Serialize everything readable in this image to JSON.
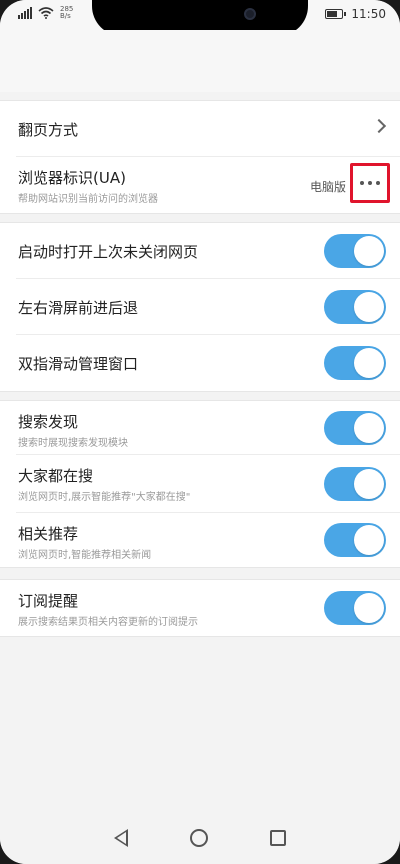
{
  "status_bar": {
    "speed_top": "285",
    "speed_unit": "B/s",
    "time": "11:50",
    "icons": [
      "signal-icon",
      "wifi-icon",
      "battery-icon"
    ]
  },
  "settings": {
    "group1": [
      {
        "title": "翻页方式",
        "type": "chevron"
      },
      {
        "title": "浏览器标识(UA)",
        "subtitle": "帮助网站识别当前访问的浏览器",
        "value": "电脑版",
        "type": "more"
      }
    ],
    "group2": [
      {
        "title": "启动时打开上次未关闭网页",
        "on": true
      },
      {
        "title": "左右滑屏前进后退",
        "on": true
      },
      {
        "title": "双指滑动管理窗口",
        "on": true
      }
    ],
    "group3": [
      {
        "title": "搜索发现",
        "subtitle": "搜索时展现搜索发现模块",
        "on": true
      },
      {
        "title": "大家都在搜",
        "subtitle": "浏览网页时,展示智能推荐\"大家都在搜\"",
        "on": true
      },
      {
        "title": "相关推荐",
        "subtitle": "浏览网页时,智能推荐相关新闻",
        "on": true
      }
    ],
    "group4": [
      {
        "title": "订阅提醒",
        "subtitle": "展示搜索结果页相关内容更新的订阅提示",
        "on": true
      }
    ]
  },
  "colors": {
    "toggle_on": "#4aa6e6",
    "highlight_box": "#e0142c"
  }
}
